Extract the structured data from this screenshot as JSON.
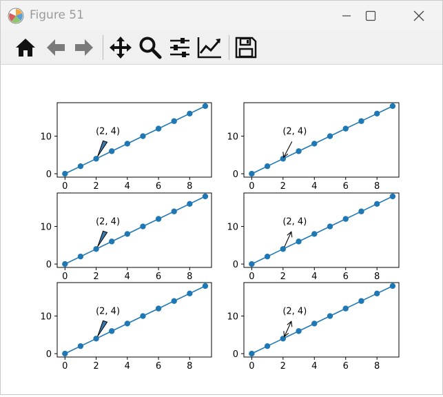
{
  "window": {
    "title": "Figure 51"
  },
  "toolbar": {
    "buttons": [
      {
        "name": "home",
        "icon": "home-icon"
      },
      {
        "name": "back",
        "icon": "arrow-left-icon"
      },
      {
        "name": "forward",
        "icon": "arrow-right-icon"
      },
      {
        "name": "pan",
        "icon": "move-icon"
      },
      {
        "name": "zoom",
        "icon": "magnifier-icon"
      },
      {
        "name": "configure-subplots",
        "icon": "sliders-icon"
      },
      {
        "name": "edit-axis",
        "icon": "line-chart-icon"
      },
      {
        "name": "save",
        "icon": "floppy-disk-icon"
      }
    ]
  },
  "colors": {
    "line": "#1f77b4",
    "arrow_fill": "#3a77a8"
  },
  "chart_data": [
    {
      "type": "line",
      "x": [
        0,
        1,
        2,
        3,
        4,
        5,
        6,
        7,
        8,
        9
      ],
      "y": [
        0,
        2,
        4,
        6,
        8,
        10,
        12,
        14,
        16,
        18
      ],
      "xticks": [
        0,
        2,
        4,
        6,
        8
      ],
      "yticks": [
        0,
        10
      ],
      "annotation": {
        "text": "(2, 4)",
        "xy": [
          2,
          4
        ],
        "arrowstyle": "fancy"
      }
    },
    {
      "type": "line",
      "x": [
        0,
        1,
        2,
        3,
        4,
        5,
        6,
        7,
        8,
        9
      ],
      "y": [
        0,
        2,
        4,
        6,
        8,
        10,
        12,
        14,
        16,
        18
      ],
      "xticks": [
        0,
        2,
        4,
        6,
        8
      ],
      "yticks": [
        0,
        10
      ],
      "annotation": {
        "text": "(2, 4)",
        "xy": [
          2,
          4
        ],
        "arrowstyle": "->"
      }
    },
    {
      "type": "line",
      "x": [
        0,
        1,
        2,
        3,
        4,
        5,
        6,
        7,
        8,
        9
      ],
      "y": [
        0,
        2,
        4,
        6,
        8,
        10,
        12,
        14,
        16,
        18
      ],
      "xticks": [
        0,
        2,
        4,
        6,
        8
      ],
      "yticks": [
        0,
        10
      ],
      "annotation": {
        "text": "(2, 4)",
        "xy": [
          2,
          4
        ],
        "arrowstyle": "wedge"
      }
    },
    {
      "type": "line",
      "x": [
        0,
        1,
        2,
        3,
        4,
        5,
        6,
        7,
        8,
        9
      ],
      "y": [
        0,
        2,
        4,
        6,
        8,
        10,
        12,
        14,
        16,
        18
      ],
      "xticks": [
        0,
        2,
        4,
        6,
        8
      ],
      "yticks": [
        0,
        10
      ],
      "annotation": {
        "text": "(2, 4)",
        "xy": [
          2,
          4
        ],
        "arrowstyle": "<-"
      }
    },
    {
      "type": "line",
      "x": [
        0,
        1,
        2,
        3,
        4,
        5,
        6,
        7,
        8,
        9
      ],
      "y": [
        0,
        2,
        4,
        6,
        8,
        10,
        12,
        14,
        16,
        18
      ],
      "xticks": [
        0,
        2,
        4,
        6,
        8
      ],
      "yticks": [
        0,
        10
      ],
      "annotation": {
        "text": "(2, 4)",
        "xy": [
          2,
          4
        ],
        "arrowstyle": "wedge"
      }
    },
    {
      "type": "line",
      "x": [
        0,
        1,
        2,
        3,
        4,
        5,
        6,
        7,
        8,
        9
      ],
      "y": [
        0,
        2,
        4,
        6,
        8,
        10,
        12,
        14,
        16,
        18
      ],
      "xticks": [
        0,
        2,
        4,
        6,
        8
      ],
      "yticks": [
        0,
        10
      ],
      "annotation": {
        "text": "(2, 4)",
        "xy": [
          2,
          4
        ],
        "arrowstyle": "<->"
      }
    }
  ]
}
